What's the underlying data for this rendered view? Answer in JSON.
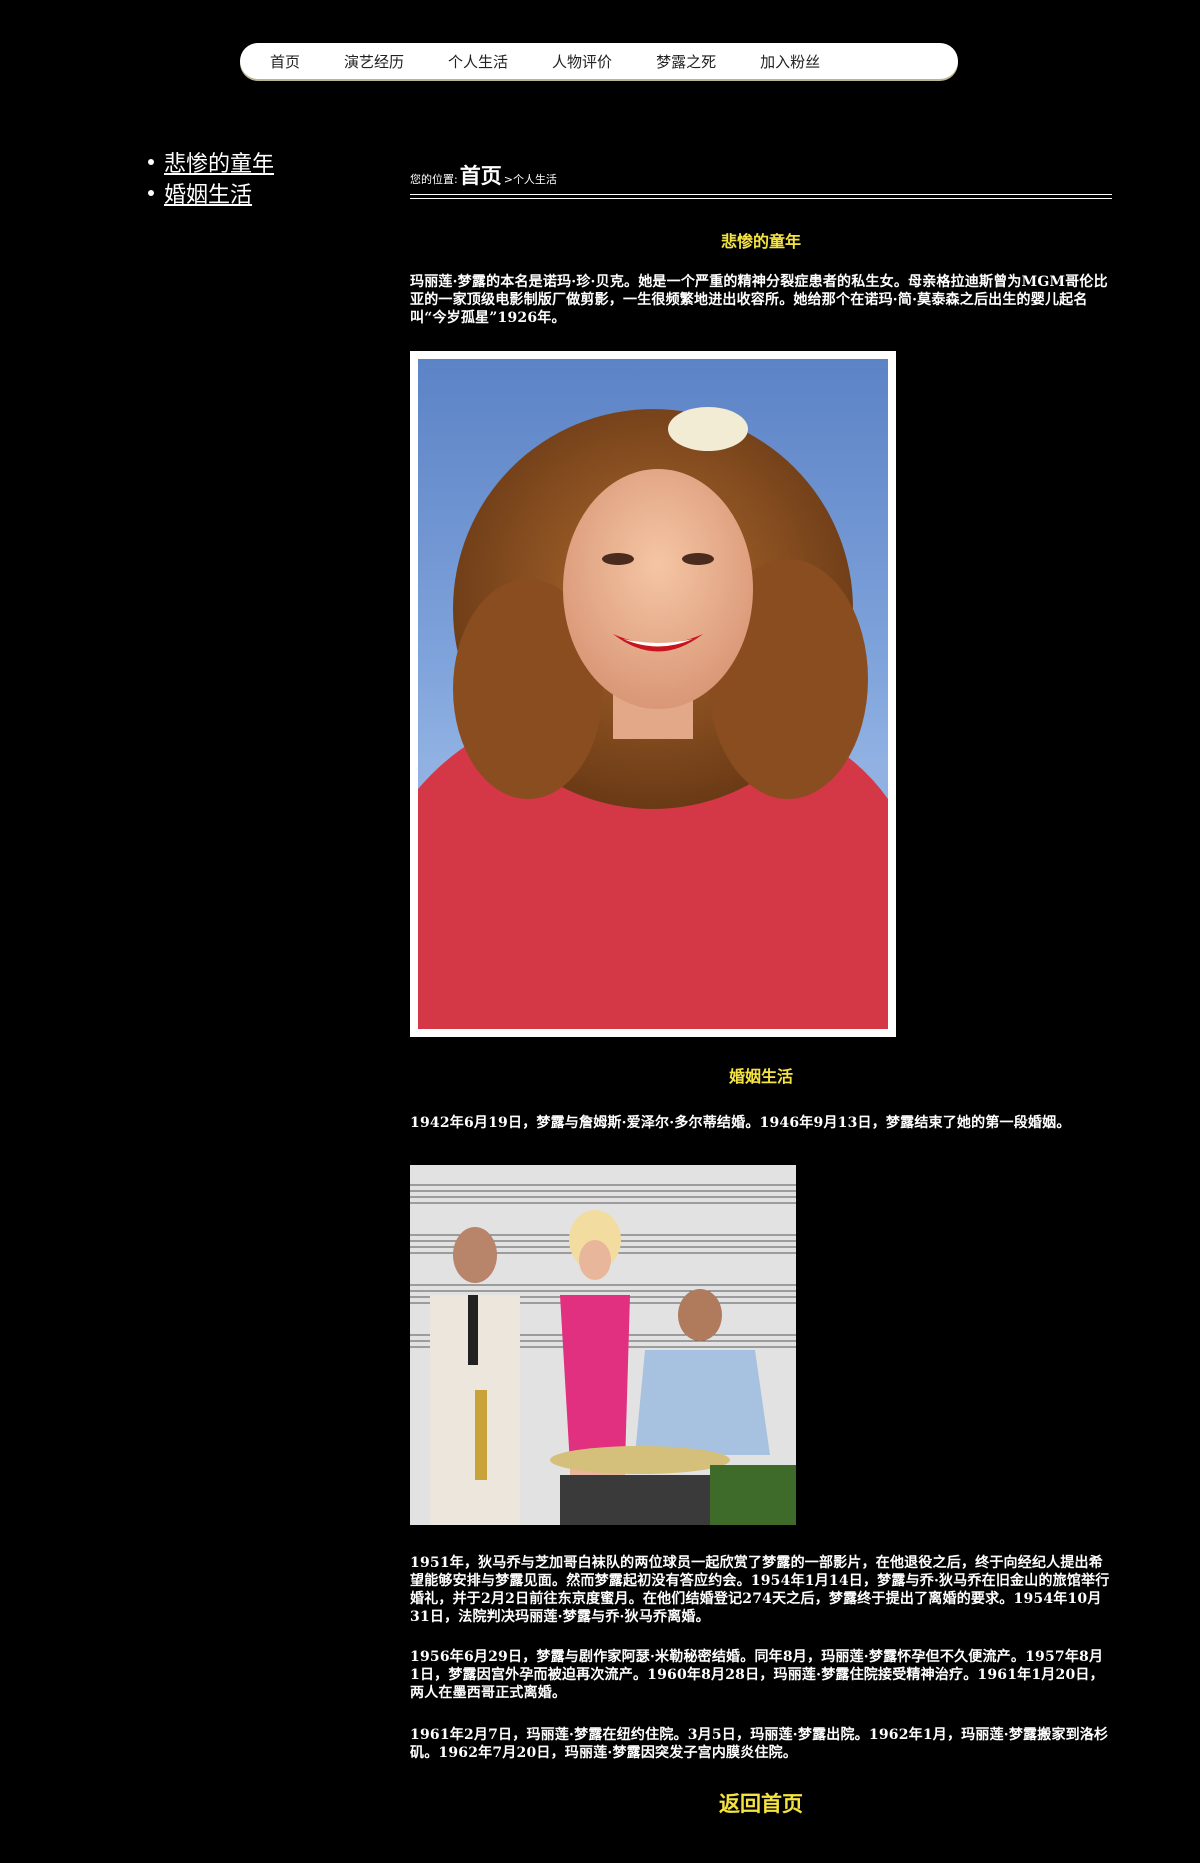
{
  "nav": {
    "items": [
      {
        "label": "首页"
      },
      {
        "label": "演艺经历"
      },
      {
        "label": "个人生活"
      },
      {
        "label": "人物评价"
      },
      {
        "label": "梦露之死"
      },
      {
        "label": "加入粉丝"
      }
    ]
  },
  "sidebar": {
    "items": [
      {
        "label": "悲惨的童年"
      },
      {
        "label": "婚姻生活"
      }
    ]
  },
  "breadcrumb": {
    "prefix": "您的位置:",
    "home": "首页",
    "separator": ">",
    "current": "个人生活"
  },
  "sections": [
    {
      "title": "悲惨的童年",
      "text": "玛丽莲·梦露的本名是诺玛·珍·贝克。她是一个严重的精神分裂症患者的私生女。母亲格拉迪斯曾为MGM哥伦比亚的一家顶级电影制版厂做剪影，一生很频繁地进出收容所。她给那个在诺玛·简·莫泰森之后出生的婴儿起名叫“今岁孤星”1926年。"
    },
    {
      "title": "婚姻生活",
      "text": "1942年6月19日，梦露与詹姆斯·爱泽尔·多尔蒂结婚。1946年9月13日，梦露结束了她的第一段婚姻。"
    }
  ],
  "paragraphs": [
    "1951年，狄马乔与芝加哥白袜队的两位球员一起欣赏了梦露的一部影片，在他退役之后，终于向经纪人提出希望能够安排与梦露见面。然而梦露起初没有答应约会。1954年1月14日，梦露与乔·狄马乔在旧金山的旅馆举行婚礼，并于2月2日前往东京度蜜月。在他们结婚登记274天之后，梦露终于提出了离婚的要求。1954年10月31日，法院判决玛丽莲·梦露与乔·狄马乔离婚。",
    "1956年6月29日，梦露与剧作家阿瑟·米勒秘密结婚。同年8月，玛丽莲·梦露怀孕但不久便流产。1957年8月1日，梦露因宫外孕而被迫再次流产。1960年8月28日，玛丽莲·梦露住院接受精神治疗。1961年1月20日，两人在墨西哥正式离婚。",
    "1961年2月7日，玛丽莲·梦露在纽约住院。3月5日，玛丽莲·梦露出院。1962年1月，玛丽莲·梦露搬家到洛杉矶。1962年7月20日，玛丽莲·梦露因突发子宫内膜炎住院。"
  ],
  "back_home": "返回首页",
  "colors": {
    "background": "#000000",
    "accent": "#f5e342",
    "nav_bg": "#ffffff"
  }
}
